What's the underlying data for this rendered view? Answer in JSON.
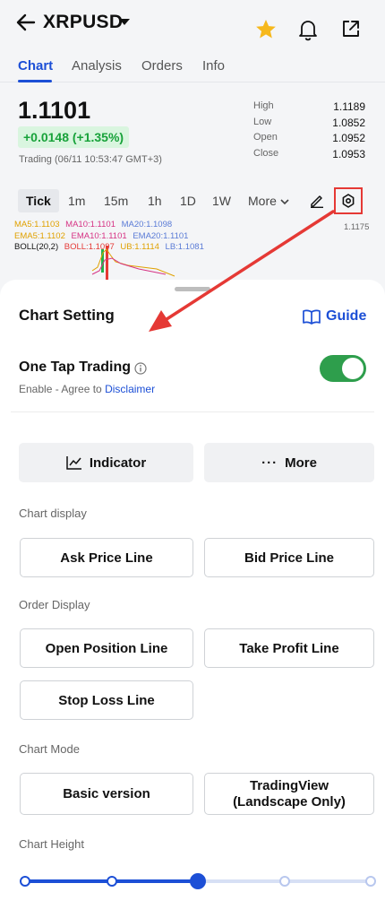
{
  "header": {
    "symbol": "XRPUSD",
    "tabs": [
      "Chart",
      "Analysis",
      "Orders",
      "Info"
    ],
    "active_tab": "Chart"
  },
  "quote": {
    "price": "1.1101",
    "change": "+0.0148 (+1.35%)",
    "trading_time": "Trading (06/11 10:53:47 GMT+3)",
    "stats": [
      {
        "label": "High",
        "value": "1.1189"
      },
      {
        "label": "Low",
        "value": "1.0852"
      },
      {
        "label": "Open",
        "value": "1.0952"
      },
      {
        "label": "Close",
        "value": "1.0953"
      }
    ]
  },
  "intervals": {
    "items": [
      "Tick",
      "1m",
      "15m",
      "1h",
      "1D",
      "1W"
    ],
    "more_label": "More",
    "active": "Tick"
  },
  "indicators": {
    "ma5": "MA5:1.1103",
    "ma10": "MA10:1.1101",
    "ma20": "MA20:1.1098",
    "ema5": "EMA5:1.1102",
    "ema10": "EMA10:1.1101",
    "ema20": "EMA20:1.1101",
    "boll": "BOLL(20,2)",
    "boll_val": "BOLL:1.1097",
    "ub": "UB:1.1114",
    "lb": "LB:1.1081",
    "y_label": "1.1175"
  },
  "sheet": {
    "title": "Chart Setting",
    "guide_label": "Guide",
    "one_tap": {
      "title": "One Tap Trading",
      "sub_prefix": "Enable - Agree to ",
      "disclaimer_link": "Disclaimer",
      "enabled": true
    },
    "indicator_label": "Indicator",
    "more_label": "More",
    "chart_display_label": "Chart display",
    "ask_line": "Ask Price Line",
    "bid_line": "Bid Price Line",
    "order_display_label": "Order Display",
    "open_position_line": "Open Position Line",
    "take_profit_line": "Take Profit Line",
    "stop_loss_line": "Stop Loss Line",
    "chart_mode_label": "Chart Mode",
    "basic_version": "Basic version",
    "tradingview_line1": "TradingView",
    "tradingview_line2": "(Landscape Only)",
    "chart_height_label": "Chart Height",
    "chart_height_level": 3,
    "chart_height_steps": 5
  },
  "colors": {
    "accent": "#1c4fd6",
    "positive": "#18a23a",
    "toggle_on": "#2e9e4c",
    "highlight": "#e53935",
    "star": "#f6b81c"
  }
}
